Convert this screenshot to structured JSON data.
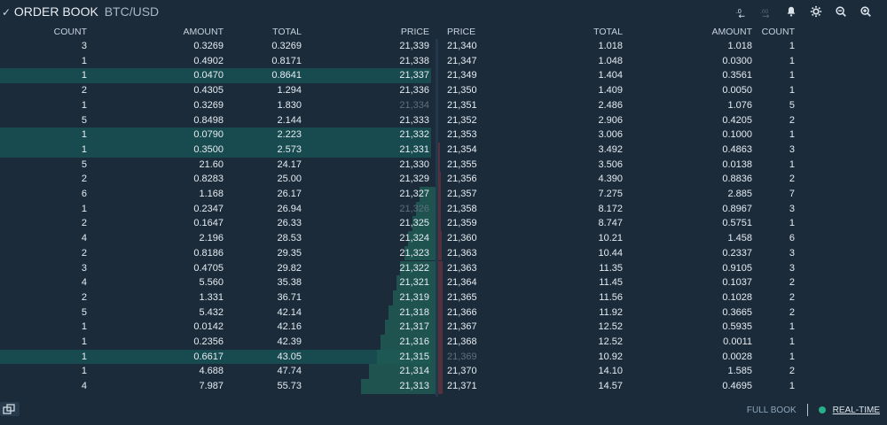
{
  "header": {
    "check_icon": "check-icon",
    "title": "ORDER BOOK",
    "pair": "BTC/USD",
    "tools": [
      {
        "name": "decrease-precision-button",
        "label": ".0",
        "icon": "decrease-precision-icon"
      },
      {
        "name": "increase-precision-button",
        "label": ".00",
        "icon": "increase-precision-icon"
      },
      {
        "name": "alerts-button",
        "icon": "bell-icon"
      },
      {
        "name": "settings-button",
        "icon": "gear-icon"
      },
      {
        "name": "zoom-out-button",
        "icon": "zoom-out-icon"
      },
      {
        "name": "zoom-in-button",
        "icon": "zoom-in-icon"
      }
    ]
  },
  "columns": {
    "bids": [
      "COUNT",
      "AMOUNT",
      "TOTAL",
      "PRICE"
    ],
    "asks": [
      "PRICE",
      "TOTAL",
      "AMOUNT",
      "COUNT"
    ]
  },
  "bids": [
    {
      "count": "3",
      "amount": "0.3269",
      "total": "0.3269",
      "price": "21,339",
      "highlight": false,
      "depth": 0.0
    },
    {
      "count": "1",
      "amount": "0.4902",
      "total": "0.8171",
      "price": "21,338",
      "highlight": false,
      "depth": 0.0
    },
    {
      "count": "1",
      "amount": "0.0470",
      "total": "0.8641",
      "price": "21,337",
      "highlight": true,
      "depth": 0.0
    },
    {
      "count": "2",
      "amount": "0.4305",
      "total": "1.294",
      "price": "21,336",
      "highlight": false,
      "depth": 0.0
    },
    {
      "count": "1",
      "amount": "0.3269",
      "total": "1.830",
      "price": "21,334",
      "highlight": false,
      "depth": 0.0,
      "dim_price": true
    },
    {
      "count": "5",
      "amount": "0.8498",
      "total": "2.144",
      "price": "21,333",
      "highlight": false,
      "depth": 0.0
    },
    {
      "count": "1",
      "amount": "0.0790",
      "total": "2.223",
      "price": "21,332",
      "highlight": true,
      "depth": 0.0
    },
    {
      "count": "1",
      "amount": "0.3500",
      "total": "2.573",
      "price": "21,331",
      "highlight": true,
      "depth": 0.0
    },
    {
      "count": "5",
      "amount": "21.60",
      "total": "24.17",
      "price": "21,330",
      "highlight": false,
      "depth": 0.0
    },
    {
      "count": "2",
      "amount": "0.8283",
      "total": "25.00",
      "price": "21,329",
      "highlight": false,
      "depth": 0.0
    },
    {
      "count": "6",
      "amount": "1.168",
      "total": "26.17",
      "price": "21,327",
      "highlight": false,
      "depth": 0.08
    },
    {
      "count": "1",
      "amount": "0.2347",
      "total": "26.94",
      "price": "21,326",
      "highlight": false,
      "depth": 0.1,
      "dim_price": true
    },
    {
      "count": "2",
      "amount": "0.1647",
      "total": "26.33",
      "price": "21,325",
      "highlight": false,
      "depth": 0.12
    },
    {
      "count": "4",
      "amount": "2.196",
      "total": "28.53",
      "price": "21,324",
      "highlight": false,
      "depth": 0.14
    },
    {
      "count": "2",
      "amount": "0.8186",
      "total": "29.35",
      "price": "21,323",
      "highlight": false,
      "depth": 0.16
    },
    {
      "count": "3",
      "amount": "0.4705",
      "total": "29.82",
      "price": "21,322",
      "highlight": false,
      "depth": 0.18
    },
    {
      "count": "4",
      "amount": "5.560",
      "total": "35.38",
      "price": "21,321",
      "highlight": false,
      "depth": 0.2
    },
    {
      "count": "2",
      "amount": "1.331",
      "total": "36.71",
      "price": "21,319",
      "highlight": false,
      "depth": 0.22
    },
    {
      "count": "5",
      "amount": "5.432",
      "total": "42.14",
      "price": "21,318",
      "highlight": false,
      "depth": 0.24
    },
    {
      "count": "1",
      "amount": "0.0142",
      "total": "42.16",
      "price": "21,317",
      "highlight": false,
      "depth": 0.26
    },
    {
      "count": "1",
      "amount": "0.2356",
      "total": "42.39",
      "price": "21,316",
      "highlight": false,
      "depth": 0.28
    },
    {
      "count": "1",
      "amount": "0.6617",
      "total": "43.05",
      "price": "21,315",
      "highlight": true,
      "depth": 0.3
    },
    {
      "count": "1",
      "amount": "4.688",
      "total": "47.74",
      "price": "21,314",
      "highlight": false,
      "depth": 0.34
    },
    {
      "count": "4",
      "amount": "7.987",
      "total": "55.73",
      "price": "21,313",
      "highlight": false,
      "depth": 0.38
    }
  ],
  "asks": [
    {
      "price": "21,340",
      "total": "1.018",
      "amount": "1.018",
      "count": "1",
      "depth": 0.0
    },
    {
      "price": "21,347",
      "total": "1.048",
      "amount": "0.0300",
      "count": "1",
      "depth": 0.0
    },
    {
      "price": "21,349",
      "total": "1.404",
      "amount": "0.3561",
      "count": "1",
      "depth": 0.0
    },
    {
      "price": "21,350",
      "total": "1.409",
      "amount": "0.0050",
      "count": "1",
      "depth": 0.0
    },
    {
      "price": "21,351",
      "total": "2.486",
      "amount": "1.076",
      "count": "5",
      "depth": 0.0
    },
    {
      "price": "21,352",
      "total": "2.906",
      "amount": "0.4205",
      "count": "2",
      "depth": 0.0
    },
    {
      "price": "21,353",
      "total": "3.006",
      "amount": "0.1000",
      "count": "1",
      "depth": 0.0
    },
    {
      "price": "21,354",
      "total": "3.492",
      "amount": "0.4863",
      "count": "3",
      "depth": 0.02
    },
    {
      "price": "21,355",
      "total": "3.506",
      "amount": "0.0138",
      "count": "1",
      "depth": 0.02
    },
    {
      "price": "21,356",
      "total": "4.390",
      "amount": "0.8836",
      "count": "2",
      "depth": 0.03
    },
    {
      "price": "21,357",
      "total": "7.275",
      "amount": "2.885",
      "count": "7",
      "depth": 0.03
    },
    {
      "price": "21,358",
      "total": "8.172",
      "amount": "0.8967",
      "count": "3",
      "depth": 0.03
    },
    {
      "price": "21,359",
      "total": "8.747",
      "amount": "0.5751",
      "count": "1",
      "depth": 0.03
    },
    {
      "price": "21,360",
      "total": "10.21",
      "amount": "1.458",
      "count": "6",
      "depth": 0.04
    },
    {
      "price": "21,363",
      "total": "10.44",
      "amount": "0.2337",
      "count": "3",
      "depth": 0.04
    },
    {
      "price": "21,363",
      "total": "11.35",
      "amount": "0.9105",
      "count": "3",
      "depth": 0.05
    },
    {
      "price": "21,364",
      "total": "11.45",
      "amount": "0.1037",
      "count": "2",
      "depth": 0.05
    },
    {
      "price": "21,365",
      "total": "11.56",
      "amount": "0.1028",
      "count": "2",
      "depth": 0.05
    },
    {
      "price": "21,366",
      "total": "11.92",
      "amount": "0.3665",
      "count": "2",
      "depth": 0.05
    },
    {
      "price": "21,367",
      "total": "12.52",
      "amount": "0.5935",
      "count": "1",
      "depth": 0.06
    },
    {
      "price": "21,368",
      "total": "12.52",
      "amount": "0.0011",
      "count": "1",
      "depth": 0.06
    },
    {
      "price": "21,369",
      "total": "10.92",
      "amount": "0.0028",
      "count": "1",
      "depth": 0.06,
      "dim_price": true
    },
    {
      "price": "21,370",
      "total": "14.10",
      "amount": "1.585",
      "count": "2",
      "depth": 0.06
    },
    {
      "price": "21,371",
      "total": "14.57",
      "amount": "0.4695",
      "count": "1",
      "depth": 0.06
    }
  ],
  "footer": {
    "expand_icon": "expand-icon",
    "full_book": "FULL BOOK",
    "realtime": "REAL-TIME",
    "realtime_dot_color": "#26b18a"
  },
  "colors": {
    "background": "#1b2b3a",
    "bid_highlight": "#174b4f",
    "bid_depth": "#1f5a55",
    "ask_depth": "#6a3440"
  }
}
